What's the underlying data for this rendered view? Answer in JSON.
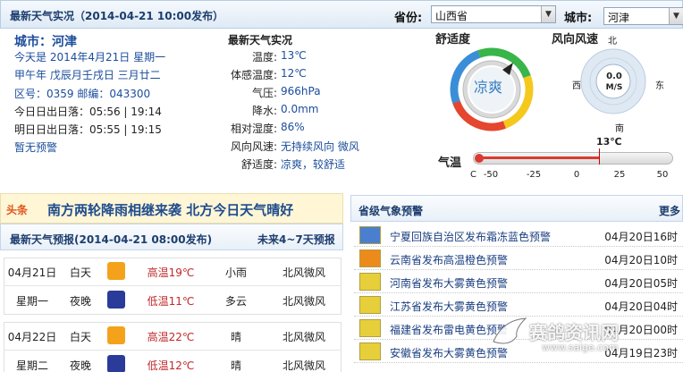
{
  "header": {
    "title": "最新天气实况（2014-04-21 10:00发布）",
    "province_label": "省份:",
    "province_value": "山西省",
    "city_label": "城市:",
    "city_value": "河津"
  },
  "city_info": {
    "city_title": "城市：河津",
    "today": "今天是 2014年4月21日 星期一",
    "lunar": "甲午年 戊辰月壬戌日 三月廿二",
    "area_code": "区号：0359  邮编：043300",
    "today_sun": "今日日出日落：05:56  |  19:14",
    "tomorrow_sun": "明日日出日落：05:55  |  19:15",
    "warning": "暂无预警"
  },
  "realtime": {
    "title": "最新天气实况",
    "rows": [
      {
        "label": "温度:",
        "value": "13℃"
      },
      {
        "label": "体感温度:",
        "value": "12℃"
      },
      {
        "label": "气压:",
        "value": "966hPa"
      },
      {
        "label": "降水:",
        "value": "0.0mm"
      },
      {
        "label": "相对湿度:",
        "value": "86%"
      },
      {
        "label": "风向风速:",
        "value": "无持续风向 微风"
      },
      {
        "label": "舒适度:",
        "value": "凉爽，较舒适"
      }
    ]
  },
  "comfort": {
    "title": "舒适度",
    "value": "凉爽"
  },
  "wind": {
    "title": "风向风速",
    "north": "北",
    "south": "南",
    "east": "东",
    "west": "西",
    "speed": "0.0",
    "unit": "M/S"
  },
  "thermo": {
    "label": "气温",
    "current": "13℃",
    "current_value": 13,
    "min": -50,
    "max": 50,
    "unit": "C",
    "ticks": [
      "-50",
      "-25",
      "0",
      "25",
      "50"
    ]
  },
  "banner": {
    "tag": "头条",
    "headline": "南方两轮降雨相继来袭  北方今日天气晴好"
  },
  "forecast": {
    "title": "最新天气预报(2014-04-21 08:00发布)",
    "more": "未来4~7天预报",
    "days": [
      {
        "date": "04月21日",
        "weekday": "星期一",
        "day": {
          "period": "白天",
          "temp": "高温19℃",
          "weather": "小雨",
          "wind": "北风微风"
        },
        "night": {
          "period": "夜晚",
          "temp": "低温11℃",
          "weather": "多云",
          "wind": "北风微风"
        }
      },
      {
        "date": "04月22日",
        "weekday": "星期二",
        "day": {
          "period": "白天",
          "temp": "高温22℃",
          "weather": "晴",
          "wind": "北风微风"
        },
        "night": {
          "period": "夜晚",
          "temp": "低温12℃",
          "weather": "晴",
          "wind": "北风微风"
        }
      }
    ]
  },
  "alerts": {
    "title": "省级气象预警",
    "more": "更多",
    "items": [
      {
        "text": "宁夏回族自治区发布霜冻蓝色预警",
        "date": "04月20日16时",
        "color": "#4a7fd0"
      },
      {
        "text": "云南省发布高温橙色预警",
        "date": "04月20日10时",
        "color": "#ec8a1c"
      },
      {
        "text": "河南省发布大雾黄色预警",
        "date": "04月20日05时",
        "color": "#e6cf3a"
      },
      {
        "text": "江苏省发布大雾黄色预警",
        "date": "04月20日04时",
        "color": "#e6cf3a"
      },
      {
        "text": "福建省发布雷电黄色预警",
        "date": "04月20日00时",
        "color": "#e6cf3a"
      },
      {
        "text": "安徽省发布大雾黄色预警",
        "date": "04月19日23时",
        "color": "#e6cf3a"
      }
    ]
  },
  "watermark": {
    "name": "赛鸽资讯网",
    "url": "www.saige.com"
  }
}
